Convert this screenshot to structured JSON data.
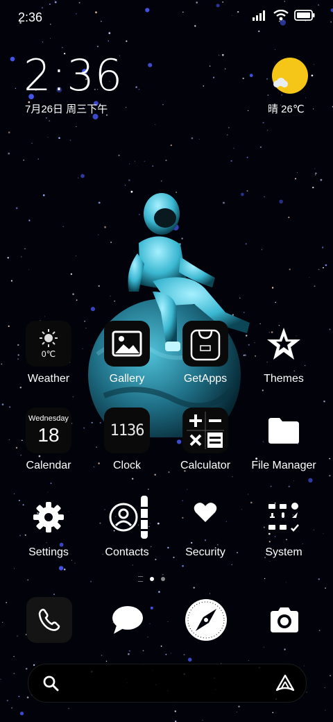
{
  "status_bar": {
    "time": "2:36",
    "icons": [
      "signal-icon",
      "wifi-icon",
      "battery-icon"
    ]
  },
  "clock_widget": {
    "time": "2:36",
    "date": "7月26日 周三下午"
  },
  "weather_widget": {
    "icon": "sun-cloud-icon",
    "text": "晴 26℃"
  },
  "apps": [
    {
      "label": "Weather",
      "icon": "weather-icon",
      "tile_text": "0℃"
    },
    {
      "label": "Gallery",
      "icon": "gallery-icon"
    },
    {
      "label": "GetApps",
      "icon": "getapps-icon"
    },
    {
      "label": "Themes",
      "icon": "themes-icon"
    },
    {
      "label": "Calendar",
      "icon": "calendar-icon",
      "tile_day": "Wednesday",
      "tile_date": "18"
    },
    {
      "label": "Clock",
      "icon": "clock-icon",
      "tile_text": "1136"
    },
    {
      "label": "Calculator",
      "icon": "calculator-icon"
    },
    {
      "label": "File Manager",
      "icon": "folder-icon"
    },
    {
      "label": "Settings",
      "icon": "gear-icon"
    },
    {
      "label": "Contacts",
      "icon": "contacts-icon"
    },
    {
      "label": "Security",
      "icon": "heart-icon"
    },
    {
      "label": "System",
      "icon": "system-tools-icon"
    }
  ],
  "page_indicator": {
    "pages": 2,
    "current": 1
  },
  "dock": [
    {
      "name": "Phone",
      "icon": "phone-icon"
    },
    {
      "name": "Messages",
      "icon": "message-icon"
    },
    {
      "name": "Browser",
      "icon": "compass-icon"
    },
    {
      "name": "Camera",
      "icon": "camera-icon"
    }
  ],
  "search_bar": {
    "left_icon": "search-icon",
    "right_icon": "assistant-icon"
  },
  "colors": {
    "sun": "#f5c518",
    "planet": "#39a7c4",
    "background": "#02030a"
  }
}
